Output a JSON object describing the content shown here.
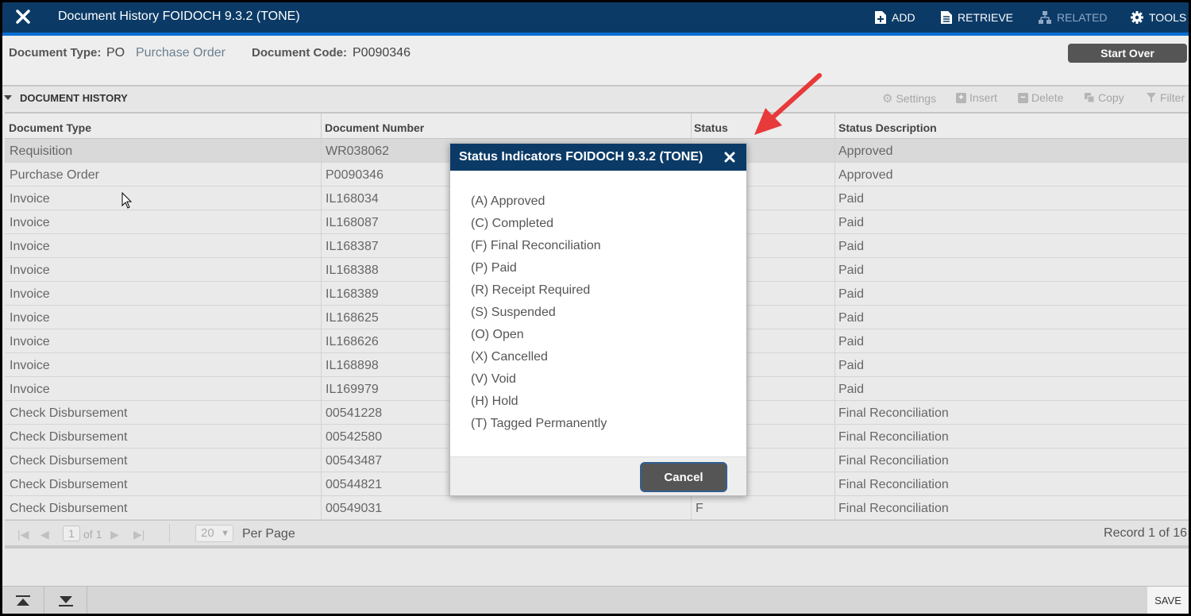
{
  "header": {
    "title": "Document History FOIDOCH 9.3.2 (TONE)",
    "actions": {
      "add": "ADD",
      "retrieve": "RETRIEVE",
      "related": "RELATED",
      "tools": "TOOLS"
    }
  },
  "key_block": {
    "doc_type_label": "Document Type:",
    "doc_type_code": "PO",
    "doc_type_desc": "Purchase Order",
    "doc_code_label": "Document Code:",
    "doc_code_value": "P0090346",
    "start_over": "Start Over"
  },
  "section": {
    "title": "DOCUMENT HISTORY",
    "tools": {
      "settings": "Settings",
      "insert": "Insert",
      "delete": "Delete",
      "copy": "Copy",
      "filter": "Filter"
    }
  },
  "grid": {
    "columns": [
      "Document Type",
      "Document Number",
      "Status",
      "Status Description"
    ],
    "rows": [
      {
        "type": "Requisition",
        "number": "WR038062",
        "status": "",
        "desc": "Approved"
      },
      {
        "type": "Purchase Order",
        "number": "P0090346",
        "status": "",
        "desc": "Approved"
      },
      {
        "type": "Invoice",
        "number": "IL168034",
        "status": "",
        "desc": "Paid"
      },
      {
        "type": "Invoice",
        "number": "IL168087",
        "status": "",
        "desc": "Paid"
      },
      {
        "type": "Invoice",
        "number": "IL168387",
        "status": "",
        "desc": "Paid"
      },
      {
        "type": "Invoice",
        "number": "IL168388",
        "status": "",
        "desc": "Paid"
      },
      {
        "type": "Invoice",
        "number": "IL168389",
        "status": "",
        "desc": "Paid"
      },
      {
        "type": "Invoice",
        "number": "IL168625",
        "status": "",
        "desc": "Paid"
      },
      {
        "type": "Invoice",
        "number": "IL168626",
        "status": "",
        "desc": "Paid"
      },
      {
        "type": "Invoice",
        "number": "IL168898",
        "status": "",
        "desc": "Paid"
      },
      {
        "type": "Invoice",
        "number": "IL169979",
        "status": "",
        "desc": "Paid"
      },
      {
        "type": "Check Disbursement",
        "number": "00541228",
        "status": "",
        "desc": "Final Reconciliation"
      },
      {
        "type": "Check Disbursement",
        "number": "00542580",
        "status": "",
        "desc": "Final Reconciliation"
      },
      {
        "type": "Check Disbursement",
        "number": "00543487",
        "status": "",
        "desc": "Final Reconciliation"
      },
      {
        "type": "Check Disbursement",
        "number": "00544821",
        "status": "",
        "desc": "Final Reconciliation"
      },
      {
        "type": "Check Disbursement",
        "number": "00549031",
        "status": "F",
        "desc": "Final Reconciliation"
      }
    ]
  },
  "pager": {
    "page": "1",
    "of_label": "of 1",
    "page_size": "20",
    "per_page": "Per Page",
    "record": "Record 1 of 16"
  },
  "footer": {
    "save": "SAVE"
  },
  "modal": {
    "title": "Status Indicators FOIDOCH 9.3.2 (TONE)",
    "items": [
      "(A) Approved",
      "(C) Completed",
      "(F) Final Reconciliation",
      "(P) Paid",
      "(R) Receipt Required",
      "(S) Suspended",
      "(O) Open",
      "(X) Cancelled",
      "(V) Void",
      "(H) Hold",
      "(T) Tagged Permanently"
    ],
    "cancel": "Cancel"
  },
  "colors": {
    "header_bg": "#0b3a66",
    "accent": "#0a6fd1",
    "annotation_arrow": "#e83a3a"
  }
}
